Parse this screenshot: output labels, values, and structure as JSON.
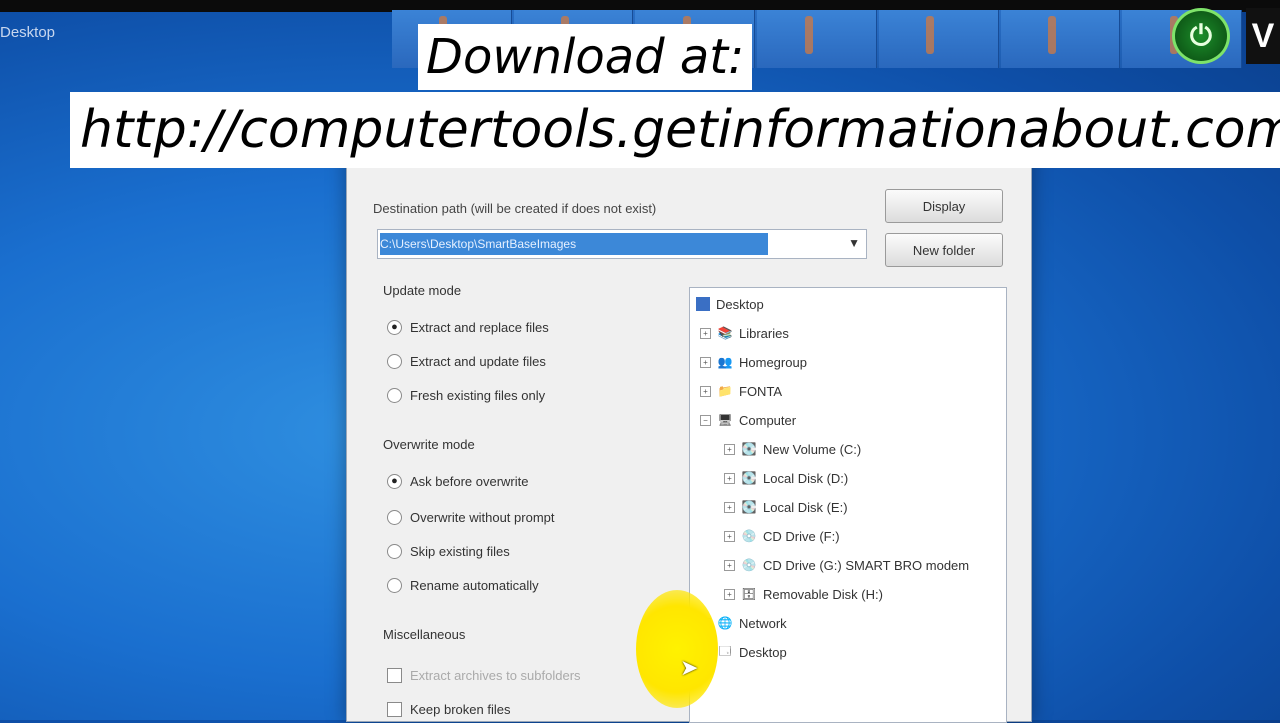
{
  "desktop": {
    "label": "Desktop"
  },
  "banner": {
    "line1": "Download at:",
    "line2": "http://computertools.getinformationabout.com"
  },
  "dialog": {
    "destination_label": "Destination path (will be created if does not exist)",
    "path_value": "C:\\Users\\Desktop\\SmartBaseImages",
    "display_button": "Display",
    "new_folder_button": "New folder",
    "update_mode": {
      "label": "Update mode",
      "options": [
        {
          "label": "Extract and replace files",
          "checked": true
        },
        {
          "label": "Extract and update files",
          "checked": false
        },
        {
          "label": "Fresh existing files only",
          "checked": false
        }
      ]
    },
    "overwrite_mode": {
      "label": "Overwrite mode",
      "options": [
        {
          "label": "Ask before overwrite",
          "checked": true
        },
        {
          "label": "Overwrite without prompt",
          "checked": false
        },
        {
          "label": "Skip existing files",
          "checked": false
        },
        {
          "label": "Rename automatically",
          "checked": false
        }
      ]
    },
    "miscellaneous": {
      "label": "Miscellaneous",
      "options": [
        {
          "label": "Extract archives to subfolders",
          "checked": false,
          "disabled": true
        },
        {
          "label": "Keep broken files",
          "checked": false
        }
      ]
    },
    "tree": [
      {
        "label": "Desktop",
        "icon": "desktop-icon",
        "level": 0
      },
      {
        "label": "Libraries",
        "icon": "libraries-icon",
        "level": 1
      },
      {
        "label": "Homegroup",
        "icon": "homegroup-icon",
        "level": 1
      },
      {
        "label": "FONTA",
        "icon": "folder-icon",
        "level": 1
      },
      {
        "label": "Computer",
        "icon": "computer-icon",
        "level": 1
      },
      {
        "label": "New Volume (C:)",
        "icon": "drive-icon",
        "level": 2
      },
      {
        "label": "Local Disk (D:)",
        "icon": "drive-icon",
        "level": 2
      },
      {
        "label": "Local Disk (E:)",
        "icon": "drive-icon",
        "level": 2
      },
      {
        "label": "CD Drive (F:)",
        "icon": "cd-icon",
        "level": 2
      },
      {
        "label": "CD Drive (G:) SMART BRO modem",
        "icon": "cd-icon",
        "level": 2
      },
      {
        "label": "Removable Disk (H:)",
        "icon": "removable-icon",
        "level": 2
      },
      {
        "label": "Network",
        "icon": "network-icon",
        "level": 1
      },
      {
        "label": "Desktop",
        "icon": "desktop-icon",
        "level": 1
      }
    ]
  },
  "colors": {
    "desktop_bg": "#1a6fcf",
    "selection": "#3c88d8",
    "cursor_highlight": "#fff200",
    "logo_green": "#1c8d2a"
  }
}
